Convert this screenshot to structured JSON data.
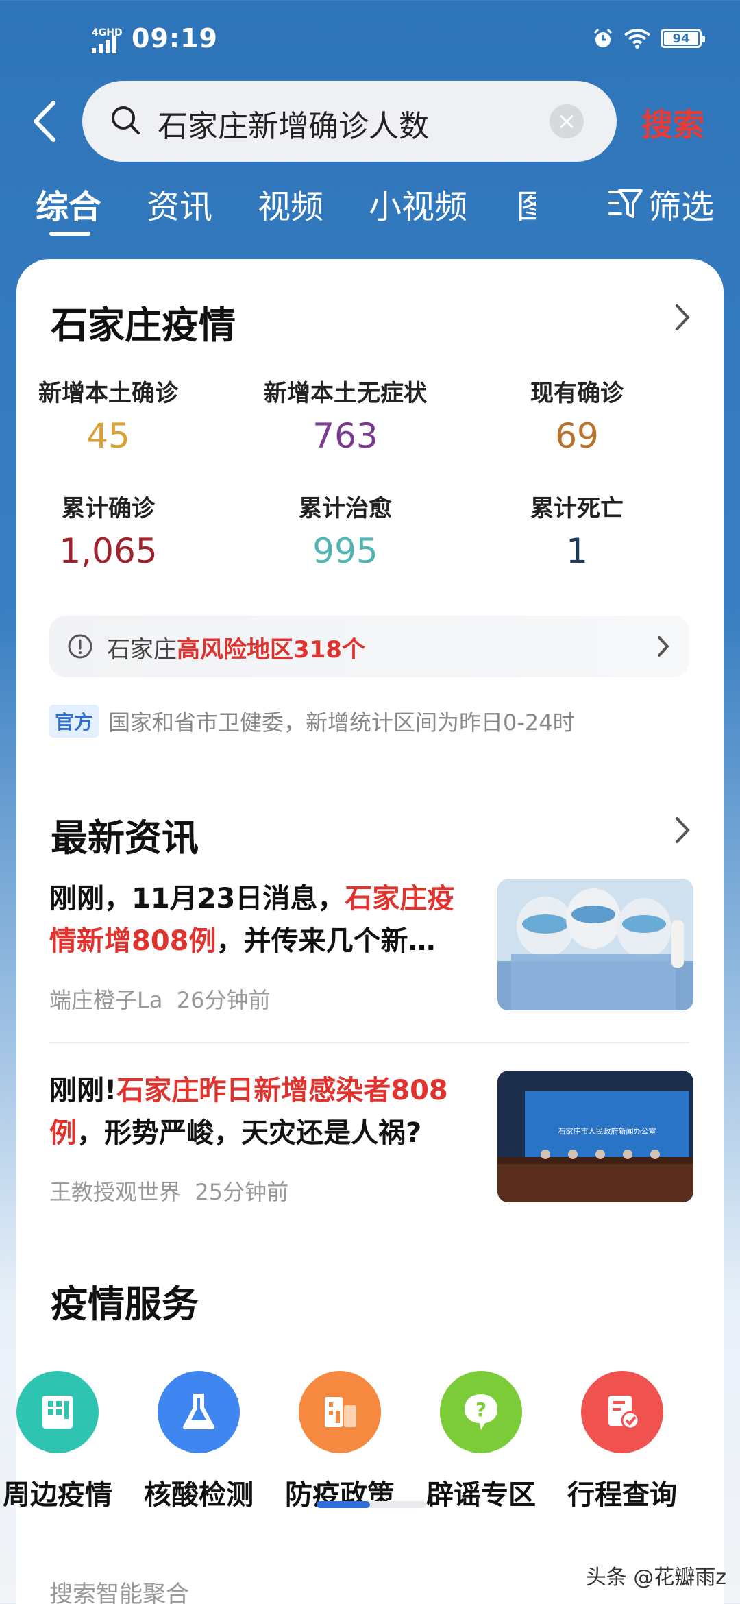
{
  "status_bar": {
    "network": "4GHD",
    "time": "09:19",
    "battery": "94"
  },
  "search": {
    "query": "石家庄新增确诊人数",
    "submit_label": "搜索"
  },
  "tabs": [
    {
      "label": "综合",
      "active": true
    },
    {
      "label": "资讯"
    },
    {
      "label": "视频"
    },
    {
      "label": "小视频"
    },
    {
      "label": "图"
    }
  ],
  "filter_label": "筛选",
  "epidemic": {
    "title": "石家庄疫情",
    "stats": [
      {
        "label": "新增本土确诊",
        "value": "45",
        "color": "#d9a233"
      },
      {
        "label": "新增本土无症状",
        "value": "763",
        "color": "#7a3b8f"
      },
      {
        "label": "现有确诊",
        "value": "69",
        "color": "#b8732c"
      },
      {
        "label": "累计确诊",
        "value": "1,065",
        "color": "#a1222d"
      },
      {
        "label": "累计治愈",
        "value": "995",
        "color": "#4fb5b0"
      },
      {
        "label": "累计死亡",
        "value": "1",
        "color": "#1f3a5a"
      }
    ],
    "risk": {
      "prefix": "石家庄",
      "highlight": "高风险地区318个"
    },
    "official_tag": "官方",
    "official_note": "国家和省市卫健委，新增统计区间为昨日0-24时"
  },
  "latest_news": {
    "title": "最新资讯",
    "items": [
      {
        "title_prefix": "刚刚，11月23日消息，",
        "title_highlight": "石家庄疫情新增808例",
        "title_suffix": "，并传来几个新…",
        "source": "端庄橙子La",
        "time": "26分钟前"
      },
      {
        "title_prefix": "刚刚!",
        "title_highlight": "石家庄昨日新增感染者808例",
        "title_suffix": "，形势严峻，天灾还是人祸?",
        "source": "王教授观世界",
        "time": "25分钟前",
        "image_banner": "石家庄市人民政府新闻办公室"
      }
    ]
  },
  "services": {
    "title": "疫情服务",
    "items": [
      {
        "label": "周边疫情",
        "icon": "building-icon",
        "color": "#2fc4b2"
      },
      {
        "label": "核酸检测",
        "icon": "flask-icon",
        "color": "#3f86f0"
      },
      {
        "label": "防疫政策",
        "icon": "policy-building-icon",
        "color": "#f5893f"
      },
      {
        "label": "辟谣专区",
        "icon": "question-icon",
        "color": "#7ccc3a"
      },
      {
        "label": "行程查询",
        "icon": "document-check-icon",
        "color": "#f0524f"
      }
    ]
  },
  "more_label": "搜索智能聚合",
  "watermark": "头条 @花瓣雨z"
}
